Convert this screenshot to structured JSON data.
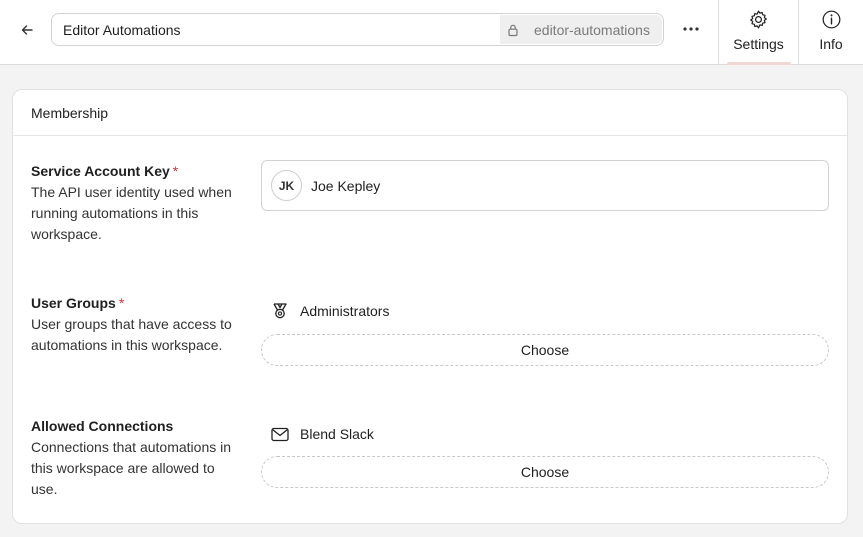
{
  "header": {
    "workspace_name": "Editor Automations",
    "slug": "editor-automations",
    "tabs": [
      {
        "label": "Settings",
        "icon": "gear-icon",
        "active": true
      },
      {
        "label": "Info",
        "icon": "info-icon",
        "active": false
      }
    ],
    "active_indicator_color": "#f4d6d4"
  },
  "membership": {
    "section_title": "Membership",
    "service_account": {
      "label": "Service Account Key",
      "required_mark": "*",
      "description": "The API user identity used when running automations in this workspace.",
      "user_initials": "JK",
      "user_name": "Joe Kepley"
    },
    "user_groups": {
      "label": "User Groups",
      "required_mark": "*",
      "description": "User groups that have access to automations in this workspace.",
      "items": [
        {
          "name": "Administrators",
          "icon": "badge-icon"
        }
      ],
      "choose_label": "Choose"
    },
    "allowed_connections": {
      "label": "Allowed Connections",
      "description": "Connections that automations in this workspace are allowed to use.",
      "items": [
        {
          "name": "Blend Slack",
          "icon": "mail-icon"
        }
      ],
      "choose_label": "Choose"
    }
  },
  "colors": {
    "required": "#d0323a",
    "background": "#f3f3f3"
  }
}
